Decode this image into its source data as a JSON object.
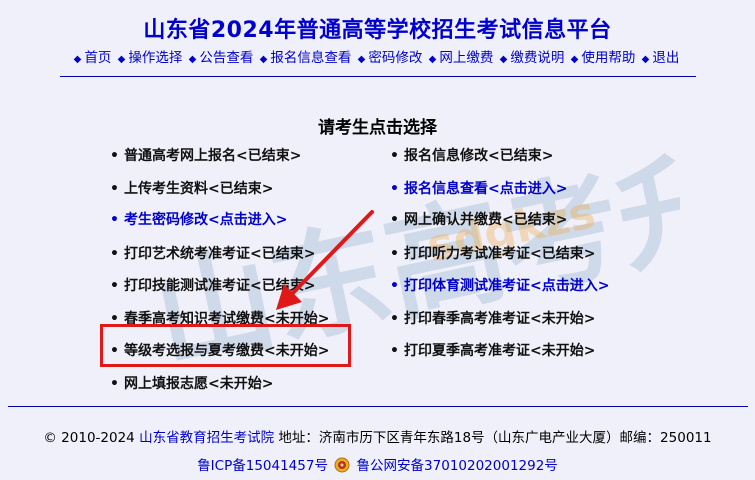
{
  "header": {
    "title": "山东省2024年普通高等学校招生考试信息平台",
    "nav": [
      "首页",
      "操作选择",
      "公告查看",
      "报名信息查看",
      "密码修改",
      "网上缴费",
      "缴费说明",
      "使用帮助",
      "退出"
    ]
  },
  "main": {
    "subtitle": "请考生点击选择",
    "left_items": [
      {
        "label": "普通高考网上报名<已结束>",
        "link": false
      },
      {
        "label": "上传考生资料<已结束>",
        "link": false
      },
      {
        "label": "考生密码修改<点击进入>",
        "link": true
      },
      {
        "label": "打印艺术统考准考证<已结束>",
        "link": false
      },
      {
        "label": "打印技能测试准考证<已结束>",
        "link": false
      },
      {
        "label": "春季高考知识考试缴费<未开始>",
        "link": false
      },
      {
        "label": "等级考选报与夏考缴费<未开始>",
        "link": false
      },
      {
        "label": "网上填报志愿<未开始>",
        "link": false
      }
    ],
    "right_items": [
      {
        "label": "报名信息修改<已结束>",
        "link": false
      },
      {
        "label": "报名信息查看<点击进入>",
        "link": true
      },
      {
        "label": "网上确认并缴费<已结束>",
        "link": false
      },
      {
        "label": "打印听力考试准考证<已结束>",
        "link": false
      },
      {
        "label": "打印体育测试准考证<点击进入>",
        "link": true
      },
      {
        "label": "打印春季高考准考证<未开始>",
        "link": false
      },
      {
        "label": "打印夏季高考准考证<未开始>",
        "link": false
      }
    ]
  },
  "watermark": {
    "text": "山东高考升学",
    "sub": "sdgkzs"
  },
  "footer": {
    "copyright": "© 2010-2024",
    "org": "山东省教育招生考试院",
    "address": "地址：济南市历下区青年东路18号（山东广电产业大厦）邮编：250011",
    "icp": "鲁ICP备15041457号",
    "police": "鲁公网安备37010202001292号"
  },
  "colors": {
    "link": "#0000cc",
    "highlight": "#e01818",
    "background": "#f0f0fa"
  }
}
